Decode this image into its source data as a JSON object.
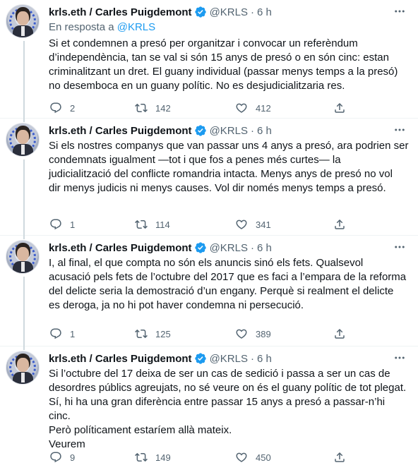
{
  "tweets": [
    {
      "name": "krls.eth / Carles Puigdemont",
      "handle": "@KRLS",
      "separator": "·",
      "time": "6 h",
      "reply_prefix": "En resposta a ",
      "reply_handle": "@KRLS",
      "lines": [
        "Si et condemnen a presó per organitzar i convocar un referèndum",
        "d’independència, tan se val si són 15 anys de presó o en són cinc: estan",
        "criminalitzant un dret. El guany individual (passar menys temps a la presó)",
        "no desemboca en un guany polític. No es desjudicialitzaria res."
      ],
      "replies": "2",
      "retweets": "142",
      "likes": "412"
    },
    {
      "name": "krls.eth / Carles Puigdemont",
      "handle": "@KRLS",
      "separator": "·",
      "time": "6 h",
      "lines": [
        "Si els nostres companys que van passar uns 4 anys a presó, ara podrien ser",
        "condemnats igualment —tot i que fos a penes més curtes— la",
        "judicialització del conflicte romandria intacta. Menys anys de presó no vol",
        "dir menys judicis ni menys causes. Vol dir només menys temps a presó."
      ],
      "replies": "1",
      "retweets": "114",
      "likes": "341"
    },
    {
      "name": "krls.eth / Carles Puigdemont",
      "handle": "@KRLS",
      "separator": "·",
      "time": "6 h",
      "lines": [
        "I, al final, el que compta no són els anuncis sinó els fets. Qualsevol",
        "acusació pels fets de l’octubre del 2017 que es faci a l’empara de la reforma",
        "del delicte seria la demostració d’un engany. Perquè si realment el delicte",
        "es deroga, ja no hi pot haver condemna ni persecució."
      ],
      "replies": "1",
      "retweets": "125",
      "likes": "389"
    },
    {
      "name": "krls.eth / Carles Puigdemont",
      "handle": "@KRLS",
      "separator": "·",
      "time": "6 h",
      "lines": [
        "Si l’octubre del 17 deixa de ser un cas de sedició i passa a ser un cas de",
        "desordres públics agreujats, no sé veure on és el guany polític de tot plegat.",
        "Sí, hi ha una gran diferència entre passar 15 anys a presó a passar-n’hi cinc.",
        "Però políticament estaríem allà mateix.",
        "Veurem"
      ],
      "replies": "9",
      "retweets": "149",
      "likes": "450"
    }
  ],
  "colors": {
    "text": "#0f1419",
    "secondary": "#536471",
    "accent": "#1d9bf0",
    "thread_line": "#cfd9de"
  },
  "icons": [
    "verified-badge-icon",
    "more-icon",
    "reply-icon",
    "retweet-icon",
    "like-icon",
    "share-icon"
  ]
}
